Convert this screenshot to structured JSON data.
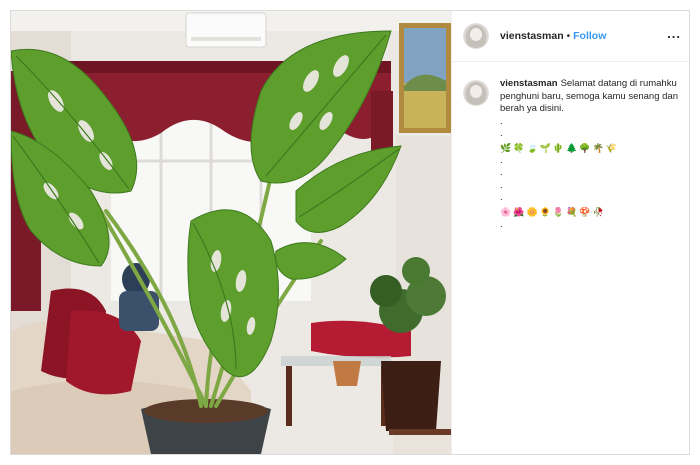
{
  "header": {
    "username": "vienstasman",
    "separator": "•",
    "follow_label": "Follow",
    "more_label": "..."
  },
  "caption": {
    "username": "vienstasman",
    "text": "Selamat datang di rumahku penghuni baru, semoga kamu senang dan berah ya disini.",
    "dots_a": [
      ".",
      "."
    ],
    "emoji_row_1": [
      "🌿",
      "🍀",
      "🍃",
      "🌱",
      "🌵",
      "🌲",
      "🌳",
      "🌴",
      "🌾"
    ],
    "dots_b": [
      ".",
      ".",
      ".",
      "."
    ],
    "emoji_row_2": [
      "🌸",
      "🌺",
      "🌼",
      "🌻",
      "🌷",
      "💐",
      "🍄",
      "🥀"
    ],
    "dots_c": [
      "."
    ]
  },
  "colors": {
    "follow": "#3897f0",
    "border": "#dbdbdb"
  },
  "photo": {
    "subject": "monstera-plant-photo"
  }
}
